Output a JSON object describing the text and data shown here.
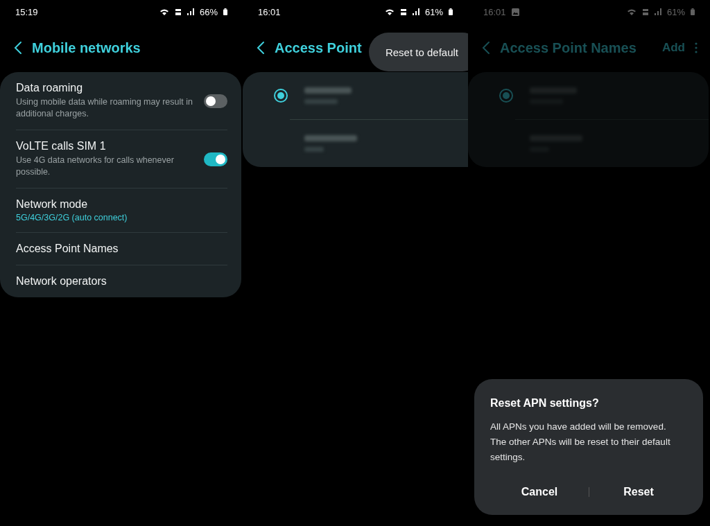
{
  "screens": [
    {
      "status_bar": {
        "time": "15:19",
        "battery": "66%"
      },
      "header": {
        "title": "Mobile networks"
      },
      "settings": [
        {
          "kind": "toggle",
          "title": "Data roaming",
          "subtitle": "Using mobile data while roaming may result in additional charges.",
          "on": false
        },
        {
          "kind": "toggle",
          "title": "VoLTE calls SIM 1",
          "subtitle": "Use 4G data networks for calls whenever possible.",
          "on": true
        },
        {
          "kind": "value",
          "title": "Network mode",
          "value": "5G/4G/3G/2G (auto connect)"
        },
        {
          "kind": "link",
          "title": "Access Point Names"
        },
        {
          "kind": "link",
          "title": "Network operators"
        }
      ]
    },
    {
      "status_bar": {
        "time": "16:01",
        "battery": "61%"
      },
      "header": {
        "title": "Access Point"
      },
      "apns": [
        {
          "selected": true
        },
        {
          "selected": false
        }
      ],
      "popup_menu": [
        "Reset to default"
      ]
    },
    {
      "status_bar": {
        "time": "16:01",
        "battery": "61%",
        "gallery_notification": true
      },
      "header": {
        "title": "Access Point Names",
        "actions": [
          "Add"
        ],
        "more_menu": true
      },
      "apns": [
        {
          "selected": true
        },
        {
          "selected": false
        }
      ],
      "dimmed": true,
      "dialog": {
        "title": "Reset APN settings?",
        "message": "All APNs you have added will be removed. The other APNs will be reset to their default settings.",
        "buttons": [
          "Cancel",
          "Reset"
        ]
      }
    }
  ]
}
